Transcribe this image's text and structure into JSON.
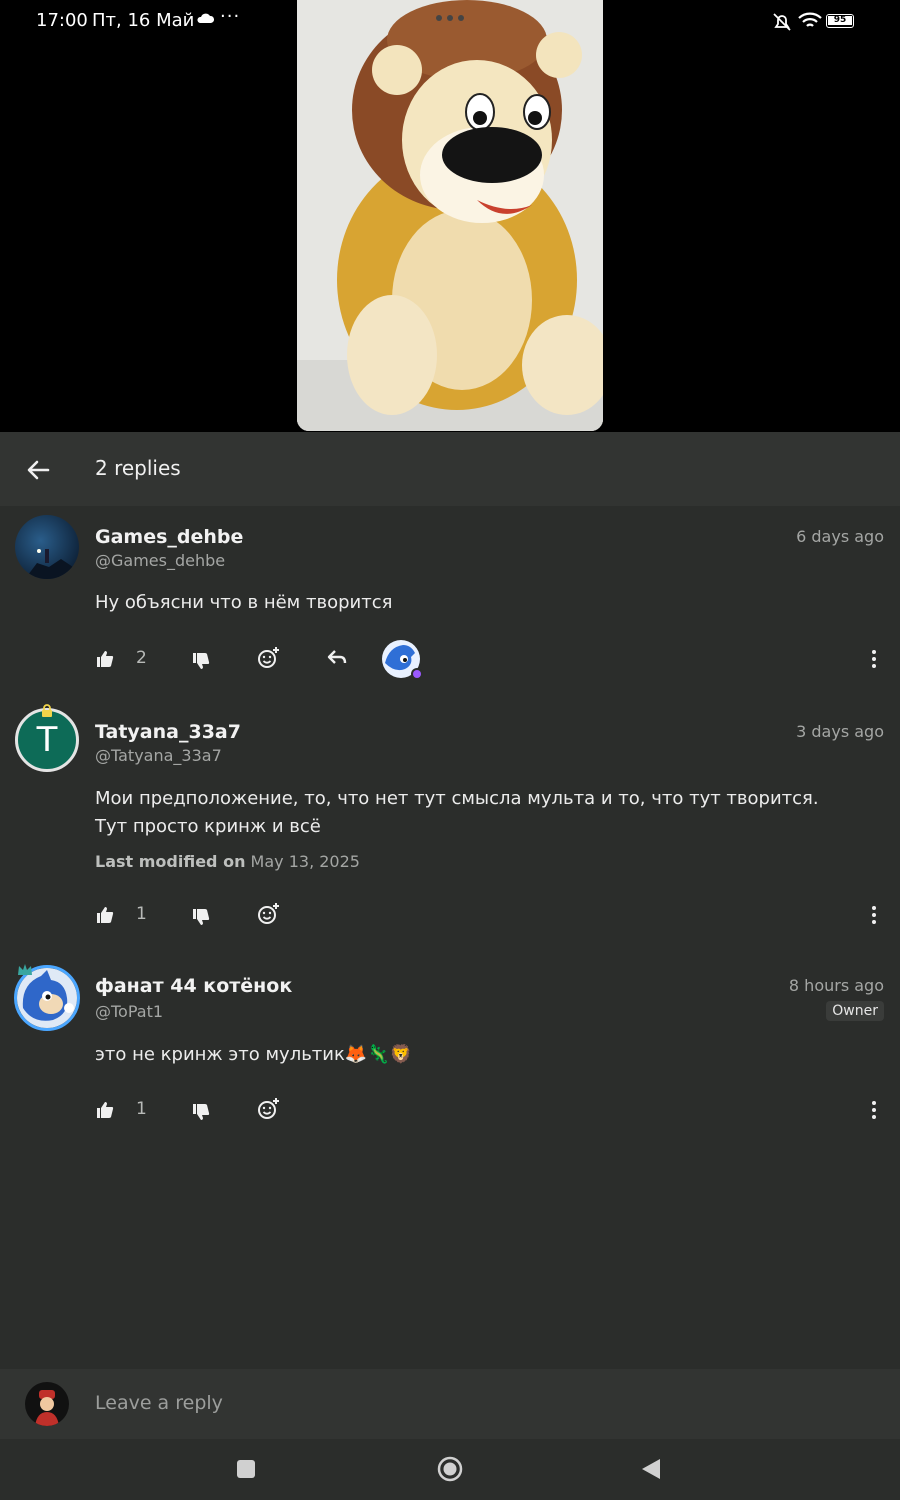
{
  "status_bar": {
    "time": "17:00",
    "date": "Пт, 16 Май",
    "battery": "95",
    "icons": [
      "cloud-icon",
      "more-dots-icon",
      "bell-muted-icon",
      "wifi-icon",
      "battery-icon"
    ]
  },
  "header": {
    "title": "2 replies",
    "back_icon": "arrow-left-icon"
  },
  "comments": [
    {
      "username": "Games_dehbe",
      "handle": "@Games_dehbe",
      "time": "6 days ago",
      "text": "Ну объясни что в нём творится",
      "likes": "2"
    },
    {
      "username": "Tatyana_33a7",
      "handle": "@Tatyana_33a7",
      "avatar_letter": "T",
      "time": "3 days ago",
      "text": "Мои предположение, то, что нет тут смысла мульта и то, что тут творится. Тут просто кринж и всё",
      "modified_label": "Last modified on",
      "modified_date": "May 13, 2025",
      "likes": "1"
    },
    {
      "username": "фанат 44 котёнок",
      "handle": "@ToPat1",
      "time": "8 hours ago",
      "badge": "Owner",
      "text": "это не кринж это мультик🦊🦎🦁",
      "likes": "1"
    }
  ],
  "reply_bar": {
    "placeholder": "Leave a reply"
  },
  "colors": {
    "background": "#2b2d2b",
    "header": "#323432",
    "text": "#ececec",
    "muted": "#a4a6a4"
  }
}
